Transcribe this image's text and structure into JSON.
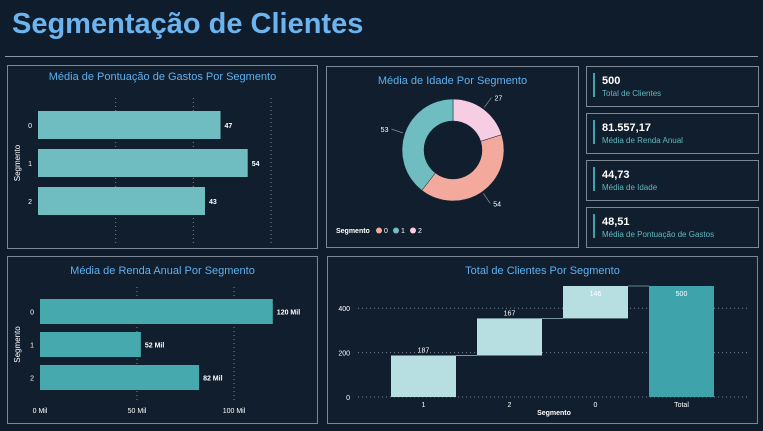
{
  "page": {
    "title": "Segmentação de Clientes"
  },
  "colors": {
    "bar_light": "#6fbdc0",
    "bar_mid": "#46a9ae",
    "waterfall_light": "#b7dfe2",
    "teal": "#3fa3ab",
    "pink": "#f4a99d",
    "lavender": "#f7cde3",
    "title_blue": "#5db0f0"
  },
  "kpis": [
    {
      "value": "500",
      "label": "Total de Clientes"
    },
    {
      "value": "81.557,17",
      "label": "Média de Renda Anual"
    },
    {
      "value": "44,73",
      "label": "Média de Idade"
    },
    {
      "value": "48,51",
      "label": "Média de Pontuação de Gastos"
    }
  ],
  "chart_data": [
    {
      "type": "bar",
      "orientation": "horizontal",
      "title": "Média de Pontuação de Gastos Por Segmento",
      "ylabel": "Segmento",
      "categories": [
        "0",
        "1",
        "2"
      ],
      "values": [
        47,
        54,
        43
      ],
      "value_labels": [
        "47",
        "54",
        "43"
      ],
      "xlim": [
        0,
        60
      ],
      "xticks": [
        "0",
        "20",
        "40",
        "60"
      ],
      "grid": "vertical dotted"
    },
    {
      "type": "pie",
      "subtype": "donut",
      "title": "Média de Idade Por Segmento",
      "legend_title": "Segmento",
      "legend_position": "bottom-left",
      "categories": [
        "0",
        "1",
        "2"
      ],
      "values": [
        54,
        53,
        27
      ],
      "value_labels": [
        "54",
        "53",
        "27"
      ]
    },
    {
      "type": "bar",
      "orientation": "horizontal",
      "title": "Média de Renda Anual Por Segmento",
      "ylabel": "Segmento",
      "categories": [
        "0",
        "1",
        "2"
      ],
      "values": [
        120,
        52,
        82
      ],
      "value_labels": [
        "120 Mil",
        "52 Mil",
        "82 Mil"
      ],
      "xlim": [
        0,
        120
      ],
      "xticks": [
        "0 Mil",
        "50 Mil",
        "100 Mil"
      ],
      "grid": "vertical dotted"
    },
    {
      "type": "bar",
      "subtype": "waterfall",
      "title": "Total de Clientes Por Segmento",
      "xlabel": "Segmento",
      "categories": [
        "1",
        "2",
        "0",
        "Total"
      ],
      "values": [
        187,
        167,
        146,
        500
      ],
      "value_labels": [
        "187",
        "167",
        "146",
        "500"
      ],
      "ylim": [
        0,
        500
      ],
      "yticks": [
        "0",
        "200",
        "400"
      ],
      "grid": "horizontal dotted"
    }
  ]
}
